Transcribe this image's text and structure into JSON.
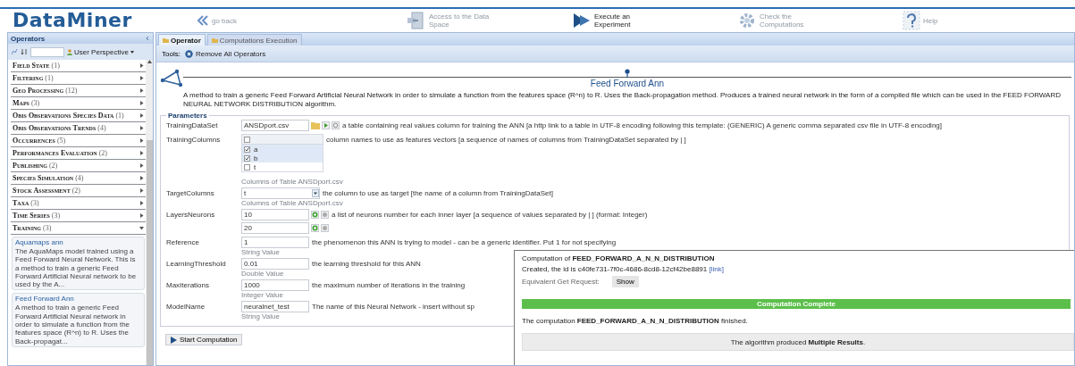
{
  "header": {
    "logo": "DataMiner",
    "nav": [
      {
        "label": "go back",
        "kind": "back",
        "selected": false
      },
      {
        "label": "Access to the Data Space",
        "kind": "data",
        "selected": false
      },
      {
        "label": "Execute an Experiment",
        "kind": "experiment",
        "selected": true
      },
      {
        "label": "Check the Computations",
        "kind": "computations",
        "selected": false
      },
      {
        "label": "Help",
        "kind": "help",
        "selected": false
      }
    ]
  },
  "sidebar": {
    "title": "Operators",
    "perspective": "User Perspective",
    "categories": [
      {
        "name": "Field State",
        "count": "(1)",
        "expanded": false
      },
      {
        "name": "Filtering",
        "count": "(1)",
        "expanded": false
      },
      {
        "name": "Geo Processing",
        "count": "(12)",
        "expanded": false
      },
      {
        "name": "Maps",
        "count": "(3)",
        "expanded": false
      },
      {
        "name": "Obis Observations Species Data",
        "count": "(1)",
        "expanded": false
      },
      {
        "name": "Obis Observations Trends",
        "count": "(4)",
        "expanded": false
      },
      {
        "name": "Occurrences",
        "count": "(5)",
        "expanded": false
      },
      {
        "name": "Performances Evaluation",
        "count": "(2)",
        "expanded": false
      },
      {
        "name": "Publishing",
        "count": "(2)",
        "expanded": false
      },
      {
        "name": "Species Simulation",
        "count": "(4)",
        "expanded": false
      },
      {
        "name": "Stock Assessment",
        "count": "(2)",
        "expanded": false
      },
      {
        "name": "Taxa",
        "count": "(3)",
        "expanded": false
      },
      {
        "name": "Time Series",
        "count": "(3)",
        "expanded": false
      },
      {
        "name": "Training",
        "count": "(3)",
        "expanded": true,
        "children": [
          {
            "title": "Aquamaps ann",
            "description": "The AquaMaps model trained using a Feed Forward Neural Network. This is a method to train a generic Feed Forward Artificial Neural network to be used by the A..."
          },
          {
            "title": "Feed Forward Ann",
            "description": "A method to train a generic Feed Forward Artificial Neural network in order to simulate a function from the features space (R^n) to R. Uses the Back-propagat..."
          }
        ]
      }
    ]
  },
  "main": {
    "tabs": [
      {
        "label": "Operator",
        "selected": true
      },
      {
        "label": "Computations Execution",
        "selected": false
      }
    ],
    "tools_label": "Tools:",
    "tools": [
      {
        "label": "Remove All Operators"
      }
    ],
    "operator": {
      "title": "Feed Forward Ann",
      "description": "A method to train a generic Feed Forward Artificial Neural Network in order to simulate a function from the features space (R^n) to R. Uses the Back-propagation method. Produces a trained neural network in the form of a compiled file which can be used in the FEED FORWARD NEURAL NETWORK DISTRIBUTION algorithm.",
      "parameters_legend": "Parameters",
      "parameters": [
        {
          "kind": "file",
          "label": "TrainingDataSet",
          "value": "ANSDport.csv",
          "description": "a table containing real values column for training the ANN [a http link to a table in UTF-8 encoding following this template: (GENERIC) A generic comma separated csv file in UTF-8 encoding]"
        },
        {
          "kind": "columns",
          "label": "TrainingColumns",
          "all_checked": false,
          "rows": [
            {
              "name": "a",
              "checked": true
            },
            {
              "name": "b",
              "checked": true
            },
            {
              "name": "t",
              "checked": false
            }
          ],
          "description": "column names to use as features vectors [a sequence of names of columns from TrainingDataSet separated by | ]",
          "hint": "Columns of Table ANSDport.csv"
        },
        {
          "kind": "column",
          "label": "TargetColumns",
          "value": "t",
          "description": "the column to use as target [the name of a column from TrainingDataSet]",
          "hint": "Columns of Table ANSDport.csv"
        },
        {
          "kind": "list",
          "label": "LayersNeurons",
          "values": [
            "10",
            "20"
          ],
          "description": "a list of neurons number for each inner layer [a sequence of values separated by | ] (format: Integer)"
        },
        {
          "kind": "text",
          "label": "Reference",
          "value": "1",
          "description": "the phenomenon this ANN is trying to model - can be a generic identifier. Put 1 for not specifying",
          "hint": "String Value"
        },
        {
          "kind": "text",
          "label": "LearningThreshold",
          "value": "0.01",
          "description": "the learning threshold for this ANN",
          "hint": "Double Value"
        },
        {
          "kind": "text",
          "label": "MaxIterations",
          "value": "1000",
          "description": "the maximum number of iterations in the training",
          "hint": "Integer Value"
        },
        {
          "kind": "text",
          "label": "ModelName",
          "value": "neuralnet_test",
          "description": "The name of this Neural Network - insert without sp",
          "hint": "String Value"
        }
      ],
      "start_button": "Start Computation"
    },
    "popup": {
      "title": "Computation of **FEED_FORWARD_A_N_N_DISTRIBUTION**",
      "created": "Created, the id is c40fe731-7f0c-4686-8cd8-12cf42be8891",
      "link": "[link]",
      "request_label": "Equivalent Get Request:",
      "request_button": "Show",
      "progress": {
        "label": "Computation Complete",
        "level": 1
      },
      "message": "The computation **FEED_FORWARD_A_N_N_DISTRIBUTION** finished.",
      "result": "The algorithm produced **Multiple Results**."
    }
  }
}
